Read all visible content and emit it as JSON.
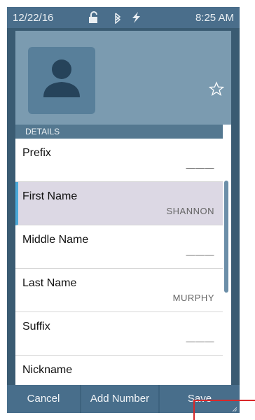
{
  "status": {
    "date": "12/22/16",
    "time": "8:25 AM",
    "icons": [
      "unlock-icon",
      "bluetooth-icon",
      "lightning-icon"
    ]
  },
  "section": {
    "title": "DETAILS"
  },
  "fields": [
    {
      "label": "Prefix",
      "value": "———"
    },
    {
      "label": "First Name",
      "value": "SHANNON"
    },
    {
      "label": "Middle Name",
      "value": "———"
    },
    {
      "label": "Last Name",
      "value": "MURPHY"
    },
    {
      "label": "Suffix",
      "value": "———"
    },
    {
      "label": "Nickname",
      "value": ""
    }
  ],
  "buttons": {
    "cancel": "Cancel",
    "add_number": "Add Number",
    "save": "Save"
  },
  "colors": {
    "accent": "#4aa8d8",
    "header": "#7b9bb0",
    "bar": "#486e8b"
  }
}
